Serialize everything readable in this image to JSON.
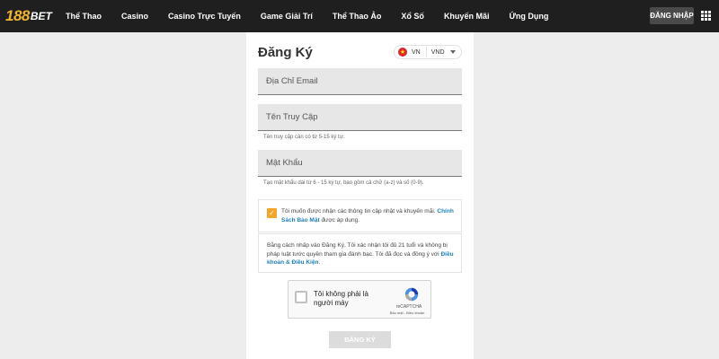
{
  "brand": {
    "logo_number": "188",
    "logo_text": "BET"
  },
  "nav": {
    "items": [
      "Thể Thao",
      "Casino",
      "Casino Trực Tuyến",
      "Game Giải Trí",
      "Thể Thao Ảo",
      "Xổ Số",
      "Khuyến Mãi",
      "Ứng Dụng"
    ],
    "login_label": "ĐĂNG NHẬP"
  },
  "form": {
    "title": "Đăng Ký",
    "language": {
      "code": "VN",
      "currency": "VND"
    },
    "email_placeholder": "Địa Chỉ Email",
    "username_placeholder": "Tên Truy Cập",
    "username_hint": "Tên truy cập cần có từ 5-15 ký tự.",
    "password_placeholder": "Mật Khẩu",
    "password_hint": "Tạo mật khẩu dài từ 6 - 15 ký tự, bao gồm cả chữ (a-z) và số (0-9).",
    "consent_text": "Tôi muốn được nhận các thông tin cập nhật và khuyến mãi.",
    "consent_link": "Chính Sách Bảo Mật",
    "consent_suffix": "được áp dụng.",
    "terms_text": "Bằng cách nhấp vào Đăng Ký, Tôi xác nhận tôi đủ 21 tuổi và không bị pháp luật tước quyền tham gia đánh bạc. Tôi đã đọc và đồng ý với",
    "terms_link": "Điều khoản & Điều Kiện",
    "terms_suffix": ".",
    "submit_label": "ĐĂNG KÝ"
  },
  "captcha": {
    "label": "Tôi không phải là người máy",
    "brand": "reCAPTCHA",
    "links": "Bảo mật - Điều khoản"
  },
  "colors": {
    "topbar": "#1f1f1f",
    "logo_accent": "#f2b233",
    "checkbox": "#f2a52b",
    "link": "#1e7fb8"
  },
  "icons": {
    "menu": "grid-menu-icon",
    "flag": "vietnam-flag-icon",
    "dropdown": "chevron-down-icon",
    "check": "checkmark-icon",
    "captcha": "recaptcha-logo-icon"
  }
}
